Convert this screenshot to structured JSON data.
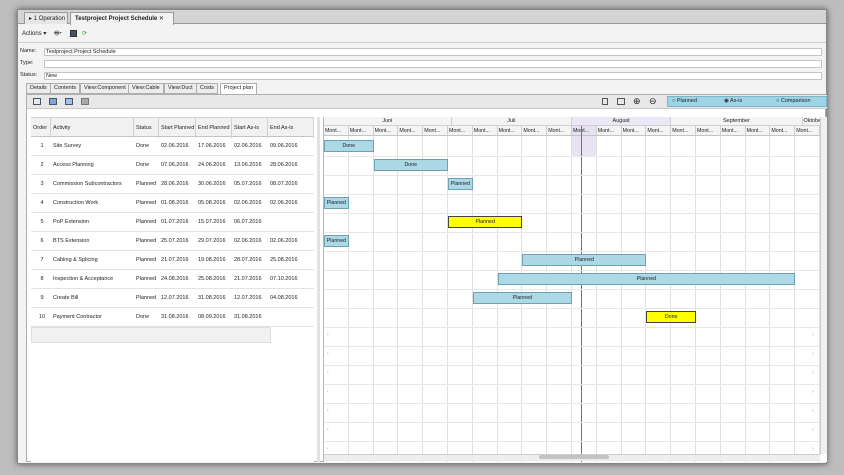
{
  "window_tabs": [
    {
      "label": "1 Operation"
    },
    {
      "label": "Testproject Project Schedule"
    }
  ],
  "toolbar": {
    "actions_label": "Actions"
  },
  "form": {
    "name_label": "Name:",
    "name_value": "Testproject Project Schedule",
    "type_label": "Type:",
    "type_value": "",
    "status_label": "Status:",
    "status_value": "New"
  },
  "subtabs": [
    "Details",
    "Contents",
    "View:Component",
    "View:Cable",
    "View:Duct",
    "Costs",
    "Project plan"
  ],
  "view_options": {
    "planned": "Planned",
    "asis": "As-is",
    "comparison": "Comparison",
    "selected": "As-is"
  },
  "columns": [
    "Order",
    "Activity",
    "Status",
    "Start Planned",
    "End Planned",
    "Start As-is",
    "End As-is"
  ],
  "rows": [
    {
      "order": "1",
      "activity": "Site Survey",
      "status": "Done",
      "start_planned": "02.06.2016",
      "end_planned": "17.06.2016",
      "start_asis": "02.06.2016",
      "end_asis": "09.06.2016"
    },
    {
      "order": "2",
      "activity": "Access Planning",
      "status": "Done",
      "start_planned": "07.06.2016",
      "end_planned": "24.06.2016",
      "start_asis": "13.06.2016",
      "end_asis": "28.06.2016"
    },
    {
      "order": "3",
      "activity": "Commission Subcontractors",
      "status": "Planned",
      "start_planned": "28.06.2016",
      "end_planned": "30.06.2016",
      "start_asis": "05.07.2016",
      "end_asis": "08.07.2016"
    },
    {
      "order": "4",
      "activity": "Construction Work",
      "status": "Planned",
      "start_planned": "01.08.2016",
      "end_planned": "05.08.2016",
      "start_asis": "02.06.2016",
      "end_asis": "02.06.2016"
    },
    {
      "order": "5",
      "activity": "PoP Extension",
      "status": "Planned",
      "start_planned": "01.07.2016",
      "end_planned": "15.07.2016",
      "start_asis": "06.07.2016",
      "end_asis": ""
    },
    {
      "order": "6",
      "activity": "BTS Extension",
      "status": "Planned",
      "start_planned": "25.07.2016",
      "end_planned": "29.07.2016",
      "start_asis": "02.06.2016",
      "end_asis": "02.06.2016"
    },
    {
      "order": "7",
      "activity": "Cabling & Splicing",
      "status": "Planned",
      "start_planned": "21.07.2016",
      "end_planned": "19.08.2016",
      "start_asis": "28.07.2016",
      "end_asis": "25.08.2016"
    },
    {
      "order": "8",
      "activity": "Inspection & Acceptance",
      "status": "Planned",
      "start_planned": "24.08.2016",
      "end_planned": "25.08.2016",
      "start_asis": "21.07.2016",
      "end_asis": "07.10.2016"
    },
    {
      "order": "9",
      "activity": "Create Bill",
      "status": "Planned",
      "start_planned": "12.07.2016",
      "end_planned": "31.08.2016",
      "start_asis": "12.07.2016",
      "end_asis": "04.08.2016"
    },
    {
      "order": "10",
      "activity": "Payment Contractor",
      "status": "Done",
      "start_planned": "31.08.2016",
      "end_planned": "08.09.2016",
      "start_asis": "31.08.2016",
      "end_asis": ""
    }
  ],
  "gantt": {
    "months": [
      "Juni",
      "Juli",
      "August",
      "September",
      "Oktober"
    ],
    "week_label": "Mont...",
    "bars": [
      {
        "row": 0,
        "label": "Done",
        "start": 0,
        "end": 2,
        "color": "blue"
      },
      {
        "row": 1,
        "label": "Done",
        "start": 2,
        "end": 5,
        "color": "blue"
      },
      {
        "row": 2,
        "label": "Planned",
        "start": 5,
        "end": 6,
        "color": "blue"
      },
      {
        "row": 3,
        "label": "Planned",
        "start": 0,
        "end": 1,
        "color": "blue"
      },
      {
        "row": 4,
        "label": "Planned",
        "start": 5,
        "end": 8,
        "color": "yellow"
      },
      {
        "row": 5,
        "label": "Planned",
        "start": 0,
        "end": 1,
        "color": "blue"
      },
      {
        "row": 6,
        "label": "Planned",
        "start": 8,
        "end": 13,
        "color": "blue"
      },
      {
        "row": 7,
        "label": "Planned",
        "start": 7,
        "end": 19,
        "color": "blue"
      },
      {
        "row": 8,
        "label": "Planned",
        "start": 6,
        "end": 10,
        "color": "blue"
      },
      {
        "row": 9,
        "label": "Done",
        "start": 13,
        "end": 15,
        "color": "yellow"
      }
    ]
  },
  "colors": {
    "bar_blue": "#add8e6",
    "bar_yellow": "#ffff00",
    "today_line": "#b040d0"
  }
}
